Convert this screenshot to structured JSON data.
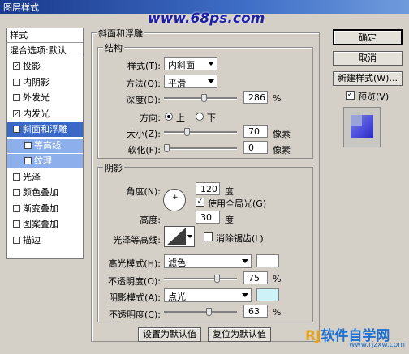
{
  "window": {
    "title": "图层样式",
    "watermark": "www.68ps.com"
  },
  "style_list": {
    "header": "样式",
    "blend_default": "混合选项:默认",
    "items": [
      {
        "label": "投影",
        "checked": true
      },
      {
        "label": "内阴影",
        "checked": false
      },
      {
        "label": "外发光",
        "checked": false
      },
      {
        "label": "内发光",
        "checked": true
      },
      {
        "label": "斜面和浮雕",
        "checked": true,
        "selected": true
      },
      {
        "label": "等高线",
        "checked": false,
        "sub": true
      },
      {
        "label": "纹理",
        "checked": false,
        "sub": true
      },
      {
        "label": "光泽",
        "checked": false
      },
      {
        "label": "颜色叠加",
        "checked": false
      },
      {
        "label": "渐变叠加",
        "checked": false
      },
      {
        "label": "图案叠加",
        "checked": false
      },
      {
        "label": "描边",
        "checked": false
      }
    ]
  },
  "bevel": {
    "title": "斜面和浮雕",
    "structure": {
      "title": "结构",
      "style_label": "样式(T):",
      "style_value": "内斜面",
      "technique_label": "方法(Q):",
      "technique_value": "平滑",
      "depth_label": "深度(D):",
      "depth_value": "286",
      "depth_unit": "%",
      "depth_slider": 0.55,
      "direction_label": "方向:",
      "direction_up": "上",
      "direction_down": "下",
      "size_label": "大小(Z):",
      "size_value": "70",
      "size_unit": "像素",
      "size_slider": 0.3,
      "soften_label": "软化(F):",
      "soften_value": "0",
      "soften_unit": "像素",
      "soften_slider": 0.0
    },
    "shading": {
      "title": "阴影",
      "angle_label": "角度(N):",
      "angle_value": "120",
      "angle_unit": "度",
      "global_light_label": "使用全局光(G)",
      "global_light": true,
      "altitude_label": "高度:",
      "altitude_value": "30",
      "altitude_unit": "度",
      "gloss_label": "光泽等高线:",
      "anti_alias_label": "消除锯齿(L)",
      "anti_alias": false,
      "highlight_label": "高光模式(H):",
      "highlight_value": "滤色",
      "highlight_color": "#ffffff",
      "opacity1_label": "不透明度(O):",
      "opacity1_value": "75",
      "opacity1_unit": "%",
      "opacity1_slider": 0.75,
      "shadow_label": "阴影模式(A):",
      "shadow_value": "点光",
      "shadow_color": "#cdf3f8",
      "opacity2_label": "不透明度(C):",
      "opacity2_value": "63",
      "opacity2_unit": "%",
      "opacity2_slider": 0.63
    },
    "make_default": "设置为默认值",
    "reset_default": "复位为默认值"
  },
  "buttons": {
    "ok": "确定",
    "cancel": "取消",
    "new_style": "新建样式(W)...",
    "preview_label": "预览(V)",
    "preview": true
  },
  "branding": {
    "name": "软件自学网",
    "url": "www.rjzxw.com"
  }
}
